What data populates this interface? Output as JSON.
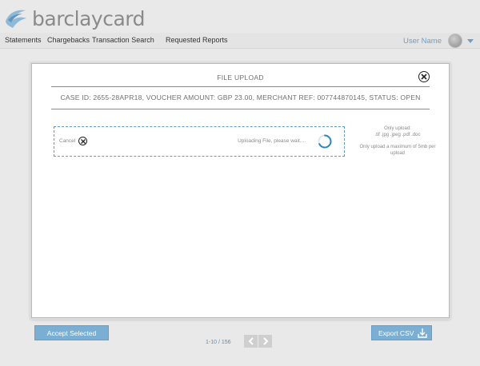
{
  "header": {
    "brand": "barclaycard",
    "nav": [
      {
        "label": "Statements"
      },
      {
        "label": "Chargebacks"
      },
      {
        "label": "Transaction Search"
      },
      {
        "label": "Requested Reports"
      }
    ],
    "user_name": "User Name"
  },
  "modal": {
    "title": "FILE UPLOAD",
    "case_info": "CASE ID: 2655-28APR18, VOUCHER AMOUNT: GBP 23.00, MERCHANT REF: 007744870145, STATUS: OPEN",
    "cancel_label": "Cancel",
    "upload_status": "Uploading File, please wait....",
    "hint_formats_title": "Only upload:",
    "hint_formats": ".tif .jpg .jpeg .pdf .doc",
    "hint_size": "Only upload a maximum of 5mb per upload"
  },
  "footer": {
    "accept_label": "Accept Selected",
    "pager_text": "1-10 / 156",
    "export_label": "Export CSV"
  },
  "colors": {
    "accent": "#7aaed2",
    "dash": "#5a9fc9",
    "link": "#6b9fc7"
  }
}
